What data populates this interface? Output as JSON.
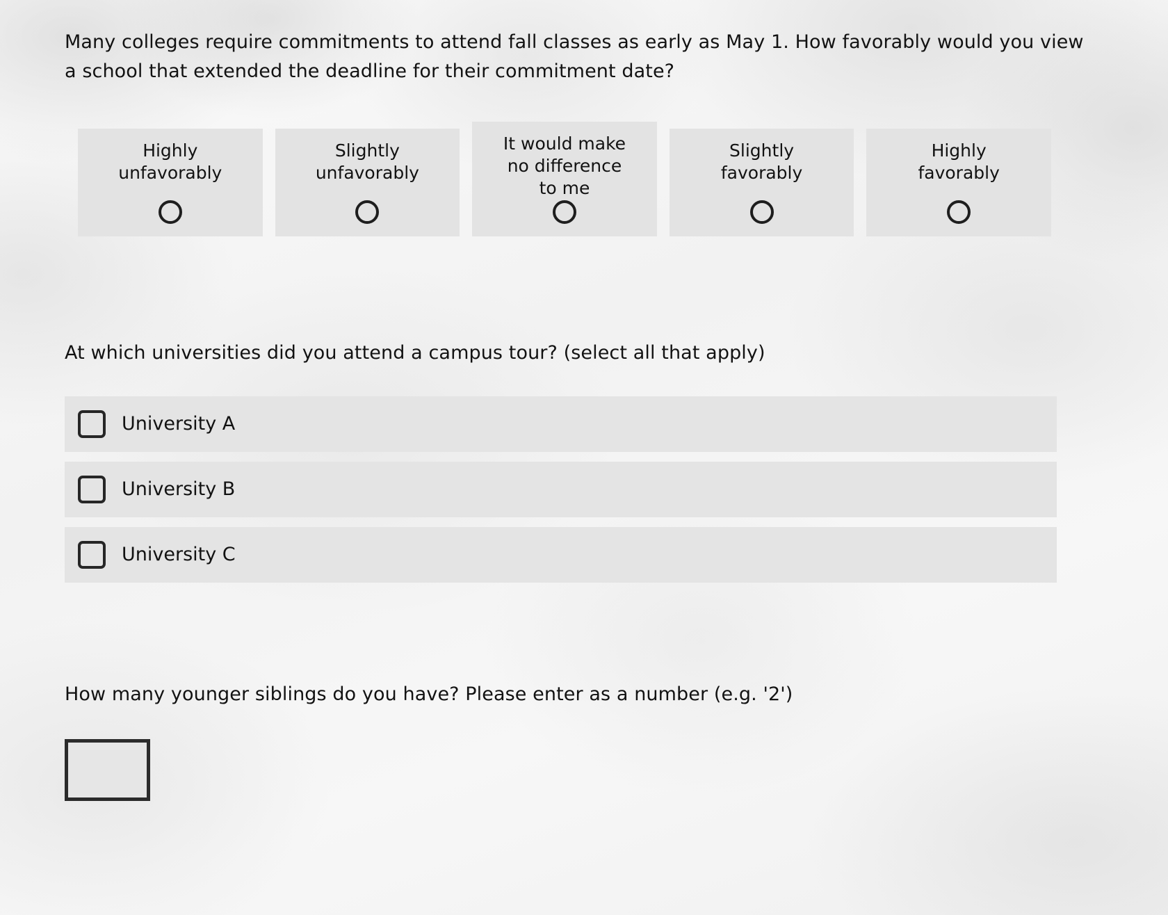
{
  "background": {
    "color": "#f6f6f6"
  },
  "questions": {
    "favorability": {
      "prompt": "Many colleges require commitments to attend fall classes as early as May 1. How favorably would you view a school that extended the deadline for their commitment date?",
      "input_type": "radio-scale",
      "options": [
        {
          "label": "Highly\nunfavorably",
          "lines": 2,
          "selected": false,
          "icon": "radio-unchecked-icon"
        },
        {
          "label": "Slightly\nunfavorably",
          "lines": 2,
          "selected": false,
          "icon": "radio-unchecked-icon"
        },
        {
          "label": "It would make\nno difference\nto me",
          "lines": 3,
          "selected": false,
          "icon": "radio-unchecked-icon"
        },
        {
          "label": "Slightly\nfavorably",
          "lines": 2,
          "selected": false,
          "icon": "radio-unchecked-icon"
        },
        {
          "label": "Highly\nfavorably",
          "lines": 2,
          "selected": false,
          "icon": "radio-unchecked-icon"
        }
      ]
    },
    "campus_tour": {
      "prompt": "At which universities did you attend a campus tour? (select all that apply)",
      "input_type": "checkbox-list",
      "options": [
        {
          "label": "University A",
          "checked": false,
          "icon": "checkbox-unchecked-icon"
        },
        {
          "label": "University B",
          "checked": false,
          "icon": "checkbox-unchecked-icon"
        },
        {
          "label": "University C",
          "checked": false,
          "icon": "checkbox-unchecked-icon"
        }
      ]
    },
    "siblings": {
      "prompt": "How many younger siblings do you have? Please enter as a number (e.g. '2')",
      "input_type": "text",
      "value": "",
      "placeholder": ""
    }
  },
  "colors": {
    "option_background": "#e3e3e3",
    "row_background": "#e4e4e4",
    "control_border": "#262626",
    "text": "#121212"
  }
}
